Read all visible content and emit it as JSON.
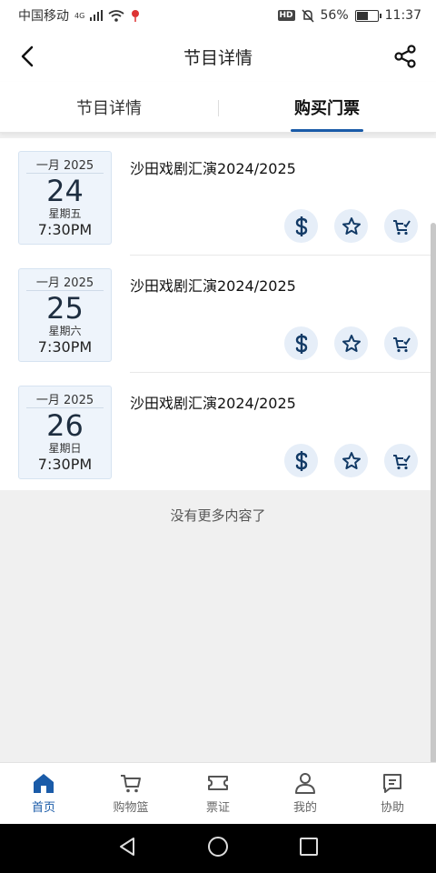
{
  "status_bar": {
    "carrier": "中国移动",
    "network_label": "4G",
    "hd_label": "HD",
    "battery_percent": "56%",
    "battery_level": 0.56,
    "time": "11:37"
  },
  "header": {
    "title": "节目详情"
  },
  "tabs": [
    {
      "label": "节目详情",
      "active": false
    },
    {
      "label": "购买门票",
      "active": true
    }
  ],
  "events": [
    {
      "month": "一月 2025",
      "day": "24",
      "weekday": "星期五",
      "time": "7:30PM",
      "title": "沙田戏剧汇演2024/2025"
    },
    {
      "month": "一月 2025",
      "day": "25",
      "weekday": "星期六",
      "time": "7:30PM",
      "title": "沙田戏剧汇演2024/2025"
    },
    {
      "month": "一月 2025",
      "day": "26",
      "weekday": "星期日",
      "time": "7:30PM",
      "title": "沙田戏剧汇演2024/2025"
    }
  ],
  "list_end_message": "没有更多内容了",
  "bottom_nav": [
    {
      "label": "首页",
      "icon": "home-icon",
      "active": true
    },
    {
      "label": "购物篮",
      "icon": "cart-icon",
      "active": false
    },
    {
      "label": "票证",
      "icon": "ticket-icon",
      "active": false
    },
    {
      "label": "我的",
      "icon": "user-icon",
      "active": false
    },
    {
      "label": "协助",
      "icon": "help-icon",
      "active": false
    }
  ],
  "colors": {
    "accent": "#1a5ba8",
    "action_bg": "#e6eef8",
    "date_bg": "#eef4fb"
  }
}
